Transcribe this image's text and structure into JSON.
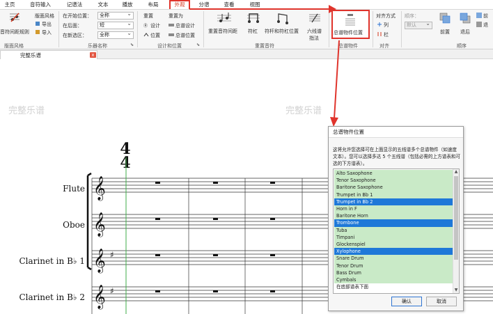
{
  "menu": {
    "tabs": [
      "主页",
      "音符输入",
      "记谱法",
      "文本",
      "播放",
      "布局",
      "外观",
      "分谱",
      "查看",
      "视图"
    ],
    "active_tab": "外观"
  },
  "ribbon": {
    "house_style": {
      "spacing_rules": "音符间距规则",
      "style_label": "版面风格",
      "export": "导出",
      "import": "导入",
      "group": "版面风格"
    },
    "instrument_names": {
      "at_start_label": "在开始位置：",
      "at_start_value": "全称",
      "subsequent_label": "在后面：",
      "subsequent_value": "短",
      "new_section_label": "在新选区：",
      "new_section_value": "全称",
      "group": "乐器名称"
    },
    "design_position": {
      "reset": "重置",
      "reset_as": "重置为",
      "design": "设计",
      "score_design": "总谱设计",
      "position": "位置",
      "score_position": "总谱位置",
      "group": "设计和位置"
    },
    "reset_notes": {
      "reset_spacing": "重置音符间距",
      "stems": "符杠",
      "stems_beams": "符杆和符杠位置",
      "six_line": "六线谱",
      "fingering": "指法",
      "group": "重置音符"
    },
    "score_objects": {
      "button": "总谱物件位置",
      "group": "总谱物件"
    },
    "align": {
      "align_label": "对齐方式",
      "rows": "列",
      "cols": "栏",
      "group": "对齐"
    },
    "order": {
      "order_label": "顺序：",
      "order_value": "默认",
      "front": "前置",
      "back": "退后",
      "front_small": "前",
      "back_small": "退",
      "group": "顺序"
    }
  },
  "document": {
    "tab_title": "完整乐谱",
    "close": "x"
  },
  "score": {
    "watermark_left": "完整乐谱",
    "watermark_center": "完整乐谱",
    "time_signature": [
      "4",
      "4"
    ],
    "instruments": [
      "Flute",
      "Oboe",
      "Clarinet in B♭ 1",
      "Clarinet in B♭ 2"
    ]
  },
  "dialog": {
    "title": "总谱物件位置",
    "description": "这将允许您选择可在上面显示的五线谱多个总谱物件（如速度文本）。您可以选择多达 5 个五线谱（包括必需的上方谱表和可选的下方谱表）。",
    "items": [
      {
        "label": "Alto Saxophone",
        "state": "green"
      },
      {
        "label": "Tenor Saxophone",
        "state": "green"
      },
      {
        "label": "Baritone Saxophone",
        "state": "green"
      },
      {
        "label": "Trumpet in Bb 1",
        "state": "green"
      },
      {
        "label": "Trumpet in Bb 2",
        "state": "selected"
      },
      {
        "label": "Horn in F",
        "state": "green"
      },
      {
        "label": "Baritone Horn",
        "state": "green"
      },
      {
        "label": "Trombone",
        "state": "selected"
      },
      {
        "label": "Tuba",
        "state": "green"
      },
      {
        "label": "Timpani",
        "state": "green"
      },
      {
        "label": "Glockenspiel",
        "state": "green"
      },
      {
        "label": "Xylophone",
        "state": "selected"
      },
      {
        "label": "Snare Drum",
        "state": "green"
      },
      {
        "label": "Tenor Drum",
        "state": "green"
      },
      {
        "label": "Bass Drum",
        "state": "green"
      },
      {
        "label": "Cymbals",
        "state": "green"
      },
      {
        "label": "在底部谱表下面",
        "state": "plain"
      }
    ],
    "ok": "确认",
    "cancel": "取消"
  },
  "colors": {
    "highlight_red": "#e0342c",
    "list_green": "#c9eac7",
    "list_selected": "#1e78d8",
    "guide_green": "#3fae49"
  }
}
